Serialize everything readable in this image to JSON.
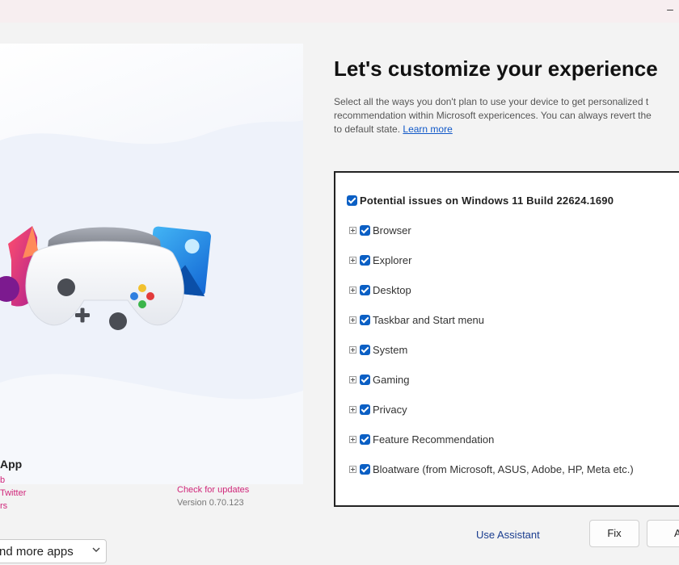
{
  "titlebar": {
    "minimize_glyph": "–"
  },
  "hero": {
    "illustration": "music-gamepad-photos-illustration"
  },
  "app_info": {
    "name": "App",
    "link_1": "b",
    "link_2": "Twitter",
    "link_3": "rs",
    "check_updates": "Check for updates",
    "version": "Version 0.70.123"
  },
  "more_apps": {
    "selected": "nd more apps"
  },
  "main": {
    "heading": "Let's customize your experience",
    "desc_line1": "Select all the ways you don't plan to use your device to get personalized t",
    "desc_line2": "recommendation within Microsoft expericences. You can always revert the",
    "desc_line3": "to default state.",
    "learn_more": "Learn more"
  },
  "tree": {
    "root": "Potential issues on Windows 11 Build 22624.1690",
    "items": [
      {
        "label": "Browser"
      },
      {
        "label": "Explorer"
      },
      {
        "label": "Desktop"
      },
      {
        "label": "Taskbar and Start menu"
      },
      {
        "label": "System"
      },
      {
        "label": "Gaming"
      },
      {
        "label": "Privacy"
      },
      {
        "label": "Feature Recommendation"
      },
      {
        "label": "Bloatware (from Microsoft, ASUS, Adobe, HP, Meta etc.)"
      }
    ]
  },
  "actions": {
    "assistant": "Use Assistant",
    "fix": "Fix",
    "next": "A"
  },
  "colors": {
    "accent": "#0b5fc4",
    "link_pink": "#d0267a",
    "link_blue": "#1058c8"
  }
}
